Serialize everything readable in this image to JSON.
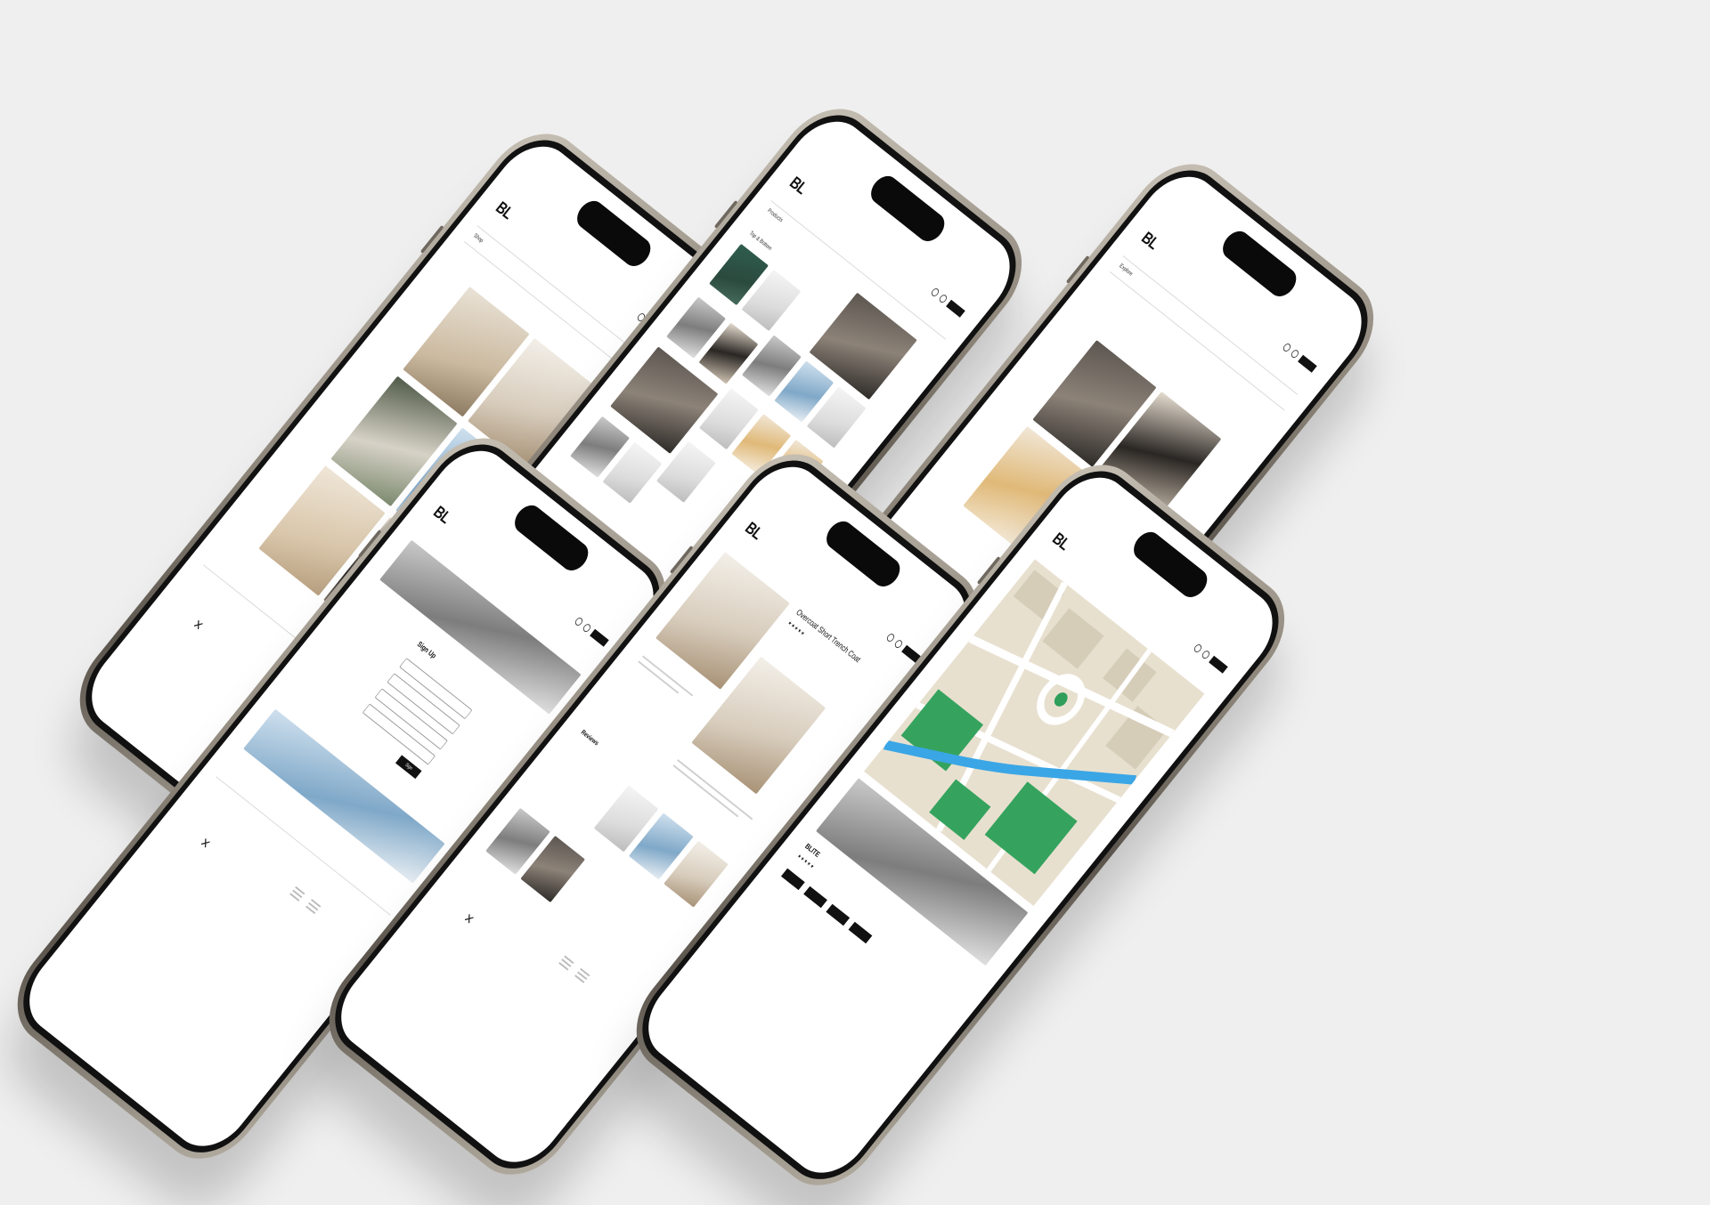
{
  "scene": {
    "background_color": "#efefef",
    "device": "smartphone mockup",
    "phone_count": 6,
    "phone_frame_color": "#8f877b",
    "screen_color": "#ffffff"
  },
  "brand": {
    "logo_text": "BL",
    "logo_wordmark": "BLITE"
  },
  "phones": [
    {
      "page": "collections-grid",
      "crumb": "Shop"
    },
    {
      "page": "catalog",
      "crumb": "Products",
      "section_label": "Top & Bottom"
    },
    {
      "page": "collection",
      "crumb": "Explore"
    },
    {
      "page": "signup",
      "form_title": "Sign Up",
      "button_label": "Sign"
    },
    {
      "page": "product-detail",
      "product_title": "Overcoat Short Trench Coat",
      "rating": "★★★★★",
      "reviews_label": "Reviews"
    },
    {
      "page": "store-location",
      "wordmark": "BLITE",
      "rating": "★★★★★"
    }
  ]
}
